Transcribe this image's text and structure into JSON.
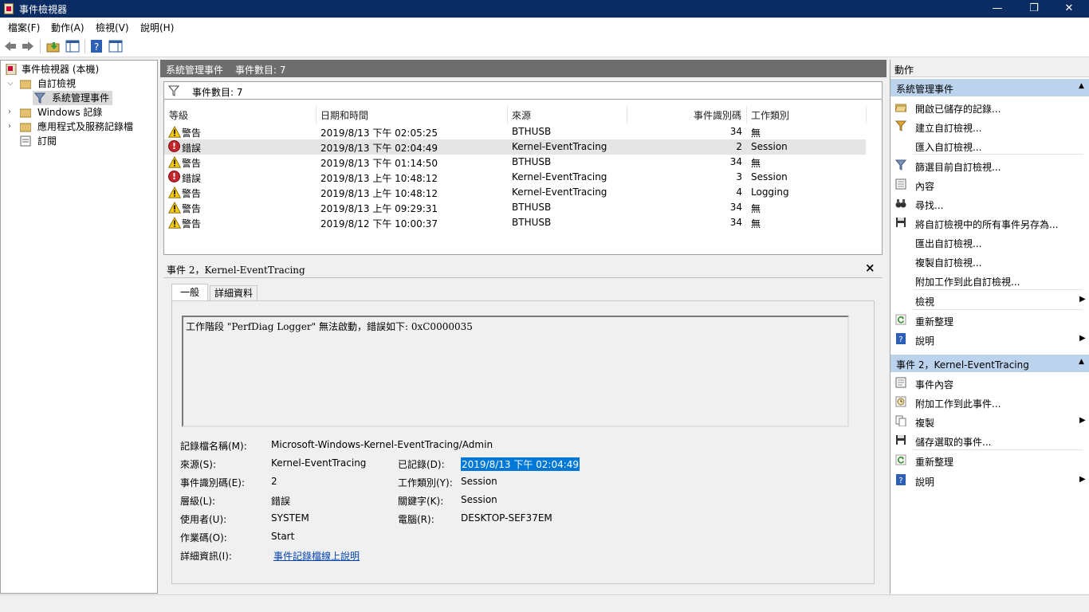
{
  "window": {
    "title": "事件檢視器",
    "minimize": "—",
    "maximize": "❐",
    "close": "✕"
  },
  "menu": [
    "檔案(F)",
    "動作(A)",
    "檢視(V)",
    "說明(H)"
  ],
  "tree": {
    "root": "事件檢視器 (本機)",
    "custom_views": "自訂檢視",
    "admin_events": "系統管理事件",
    "windows_logs": "Windows 記錄",
    "app_service_logs": "應用程式及服務記錄檔",
    "subscriptions": "訂閱"
  },
  "center": {
    "header_title": "系統管理事件",
    "header_count": "事件數目: 7",
    "filter_count": "事件數目: 7",
    "columns": {
      "level": "等級",
      "datetime": "日期和時間",
      "source": "來源",
      "event_id": "事件識別碼",
      "task_category": "工作類別"
    },
    "rows": [
      {
        "level": "警告",
        "type": "warning",
        "datetime": "2019/8/13 下午 02:05:25",
        "source": "BTHUSB",
        "event_id": "34",
        "task": "無"
      },
      {
        "level": "錯誤",
        "type": "error",
        "datetime": "2019/8/13 下午 02:04:49",
        "source": "Kernel-EventTracing",
        "event_id": "2",
        "task": "Session"
      },
      {
        "level": "警告",
        "type": "warning",
        "datetime": "2019/8/13 下午 01:14:50",
        "source": "BTHUSB",
        "event_id": "34",
        "task": "無"
      },
      {
        "level": "錯誤",
        "type": "error",
        "datetime": "2019/8/13 上午 10:48:12",
        "source": "Kernel-EventTracing",
        "event_id": "3",
        "task": "Session"
      },
      {
        "level": "警告",
        "type": "warning",
        "datetime": "2019/8/13 上午 10:48:12",
        "source": "Kernel-EventTracing",
        "event_id": "4",
        "task": "Logging"
      },
      {
        "level": "警告",
        "type": "warning",
        "datetime": "2019/8/13 上午 09:29:31",
        "source": "BTHUSB",
        "event_id": "34",
        "task": "無"
      },
      {
        "level": "警告",
        "type": "warning",
        "datetime": "2019/8/12 下午 10:00:37",
        "source": "BTHUSB",
        "event_id": "34",
        "task": "無"
      }
    ]
  },
  "detail": {
    "title": "事件 2，Kernel-EventTracing",
    "close": "×",
    "tab_general": "一般",
    "tab_details": "詳細資料",
    "message": "工作階段 \"PerfDiag Logger\" 無法啟動，錯誤如下: 0xC0000035",
    "fields": {
      "log_name_label": "記錄檔名稱(M):",
      "log_name": "Microsoft-Windows-Kernel-EventTracing/Admin",
      "source_label": "來源(S):",
      "source": "Kernel-EventTracing",
      "logged_label": "已記錄(D):",
      "logged": "2019/8/13 下午 02:04:49",
      "event_id_label": "事件識別碼(E):",
      "event_id": "2",
      "task_label": "工作類別(Y):",
      "task": "Session",
      "level_label": "層級(L):",
      "level": "錯誤",
      "keywords_label": "關鍵字(K):",
      "keywords": "Session",
      "user_label": "使用者(U):",
      "user": "SYSTEM",
      "computer_label": "電腦(R):",
      "computer": "DESKTOP-SEF37EM",
      "opcode_label": "作業碼(O):",
      "opcode": "Start",
      "more_info_label": "詳細資訊(I):",
      "more_info_link": "事件記錄檔線上說明"
    }
  },
  "actions": {
    "title": "動作",
    "section1": "系統管理事件",
    "section1_items": [
      "開啟已儲存的記錄...",
      "建立自訂檢視...",
      "匯入自訂檢視...",
      "篩選目前自訂檢視...",
      "內容",
      "尋找...",
      "將自訂檢視中的所有事件另存為...",
      "匯出自訂檢視...",
      "複製自訂檢視...",
      "附加工作到此自訂檢視...",
      "檢視",
      "重新整理",
      "說明"
    ],
    "section2": "事件 2，Kernel-EventTracing",
    "section2_items": [
      "事件內容",
      "附加工作到此事件...",
      "複製",
      "儲存選取的事件...",
      "重新整理",
      "說明"
    ]
  },
  "colors": {
    "titlebar": "#0b2c63",
    "section_header": "#bcd3ee",
    "selection": "#0078d7",
    "error": "#c1272d",
    "warning": "#f2c811"
  }
}
